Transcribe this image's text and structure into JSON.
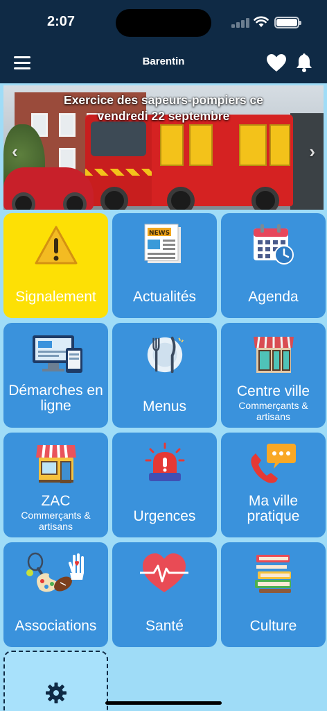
{
  "status_bar": {
    "time": "2:07"
  },
  "nav": {
    "title": "Barentin"
  },
  "banner": {
    "title": "Exercice des sapeurs-pompiers ce vendredi 22 septembre"
  },
  "tiles": [
    {
      "label": "Signalement",
      "sub": "",
      "icon": "warning-icon"
    },
    {
      "label": "Actualités",
      "sub": "",
      "icon": "newspaper-icon"
    },
    {
      "label": "Agenda",
      "sub": "",
      "icon": "calendar-icon"
    },
    {
      "label": "Démarches en ligne",
      "sub": "",
      "icon": "computer-devices-icon"
    },
    {
      "label": "Menus",
      "sub": "",
      "icon": "plate-cutlery-icon"
    },
    {
      "label": "Centre ville",
      "sub": "Commerçants & artisans",
      "icon": "storefront-icon"
    },
    {
      "label": "ZAC",
      "sub": "Commerçants & artisans",
      "icon": "shop-icon"
    },
    {
      "label": "Urgences",
      "sub": "",
      "icon": "siren-icon"
    },
    {
      "label": "Ma ville pratique",
      "sub": "",
      "icon": "phone-chat-icon"
    },
    {
      "label": "Associations",
      "sub": "",
      "icon": "sports-arts-icon"
    },
    {
      "label": "Santé",
      "sub": "",
      "icon": "heart-pulse-icon"
    },
    {
      "label": "Culture",
      "sub": "",
      "icon": "books-icon"
    }
  ],
  "settings": {
    "icon": "gear-icon"
  },
  "colors": {
    "header": "#0f2a45",
    "background": "#9fdcf7",
    "tile": "#3a92dc",
    "tile_highlight": "#fde005"
  }
}
